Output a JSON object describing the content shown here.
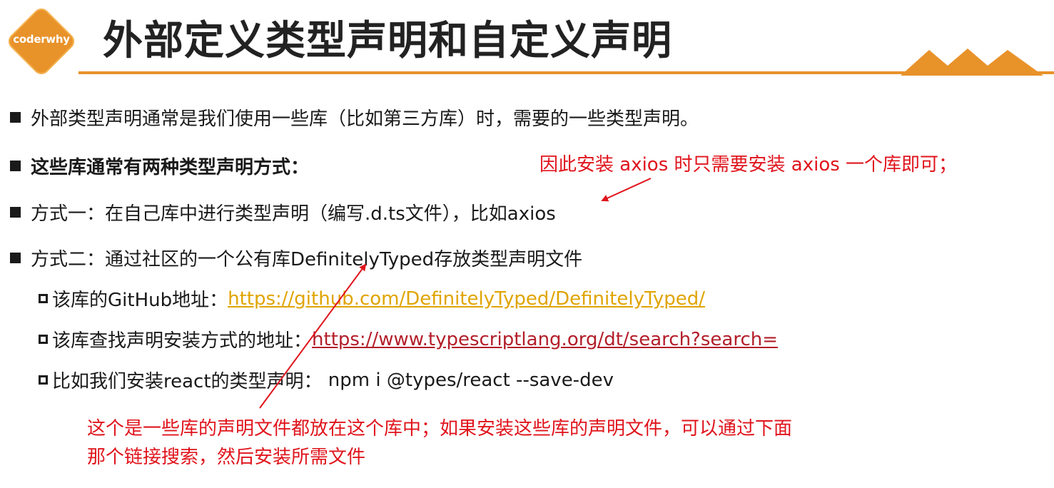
{
  "header": {
    "logo_text": "coderwhy",
    "title": "外部定义类型声明和自定义声明"
  },
  "bullets": [
    {
      "text": "外部类型声明通常是我们使用一些库（比如第三方库）时，需要的一些类型声明。"
    },
    {
      "text": "这些库通常有两种类型声明方式："
    },
    {
      "text": "方式一：在自己库中进行类型声明（编写.d.ts文件），比如axios"
    },
    {
      "text": "方式二：通过社区的一个公有库DefinitelyTyped存放类型声明文件"
    }
  ],
  "sub_items": [
    {
      "label": "该库的GitHub地址：",
      "link": "https://github.com/DefinitelyTyped/DefinitelyTyped/"
    },
    {
      "label": "该库查找声明安装方式的地址：",
      "link": "https://www.typescriptlang.org/dt/search?search="
    },
    {
      "label": "比如我们安装react的类型声明：",
      "command": " npm i @types/react --save-dev"
    }
  ],
  "annotations": {
    "axios_note": "因此安装 axios 时只需要安装 axios 一个库即可；",
    "dt_note_line1": "这个是一些库的声明文件都放在这个库中；如果安装这些库的声明文件，可以通过下面",
    "dt_note_line2": "那个链接搜索，然后安装所需文件"
  },
  "colors": {
    "accent": "#e8922a",
    "annotation": "#e0141c",
    "link_github": "#e0a400",
    "link_search": "#b31e2a"
  }
}
